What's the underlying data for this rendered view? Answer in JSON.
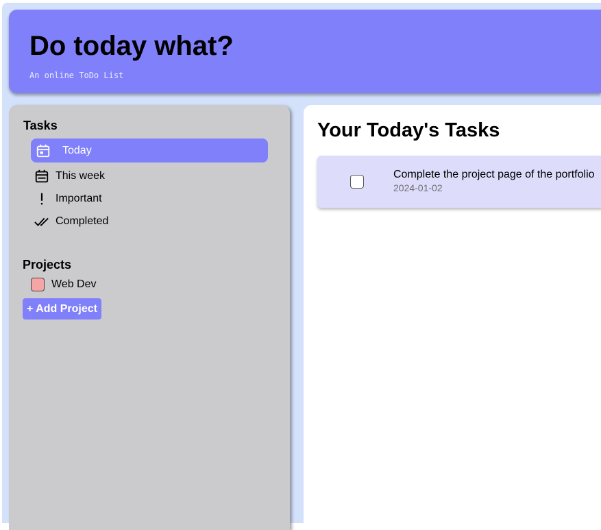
{
  "header": {
    "title": "Do today what?",
    "subtitle": "An online ToDo List"
  },
  "sidebar": {
    "tasks_title": "Tasks",
    "items": [
      {
        "label": "Today",
        "icon": "calendar-today-icon",
        "active": true
      },
      {
        "label": "This week",
        "icon": "calendar-week-icon",
        "active": false
      },
      {
        "label": "Important",
        "icon": "exclamation-icon",
        "active": false
      },
      {
        "label": "Completed",
        "icon": "double-check-icon",
        "active": false
      }
    ],
    "projects_title": "Projects",
    "projects": [
      {
        "label": "Web Dev",
        "color": "#f6a5a5"
      }
    ],
    "add_project_label": "+ Add Project"
  },
  "main": {
    "title": "Your Today's Tasks",
    "tasks": [
      {
        "text": "Complete the project page of the portfolio",
        "date": "2024-01-02",
        "done": false
      }
    ]
  },
  "colors": {
    "accent": "#8080fb",
    "background": "#d4e1fb",
    "sidebar": "#cbcbcd",
    "task_card": "#dedcfb"
  }
}
